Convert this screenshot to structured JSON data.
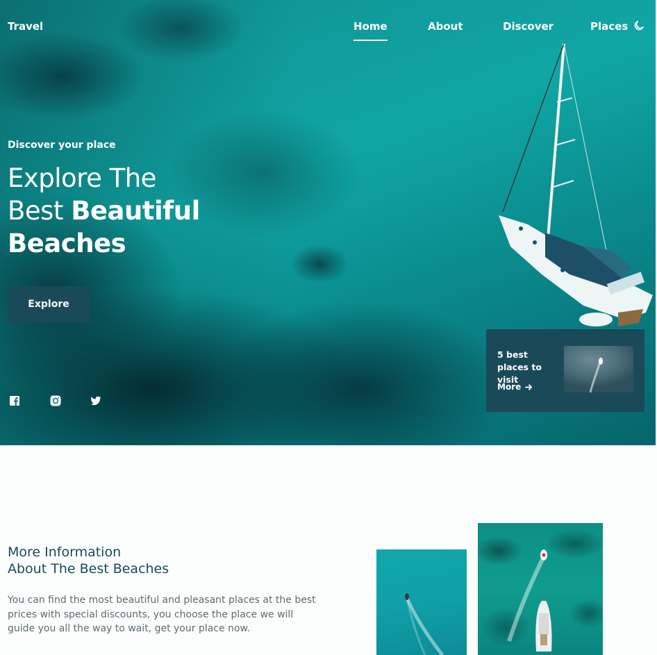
{
  "header": {
    "brand": "Travel",
    "nav": [
      {
        "label": "Home",
        "active": true
      },
      {
        "label": "About",
        "active": false
      },
      {
        "label": "Discover",
        "active": false
      },
      {
        "label": "Places",
        "active": false
      }
    ],
    "theme_toggle_icon": "moon-icon"
  },
  "hero": {
    "subtitle": "Discover your place",
    "headline_line1": "Explore The",
    "headline_line2_regular": "Best ",
    "headline_line2_bold": "Beautiful",
    "headline_line3_bold": "Beaches",
    "button_label": "Explore",
    "social_icons": [
      "facebook-icon",
      "instagram-icon",
      "twitter-icon"
    ]
  },
  "card": {
    "title": "5 best places to visit",
    "more_label": "More",
    "more_icon": "arrow-right-icon"
  },
  "info": {
    "title_line1": "More Information",
    "title_line2": "About The Best Beaches",
    "text": "You can find the most beautiful and pleasant places at the best prices with special discounts, you choose the place we will guide you all the way to wait, get your place now."
  },
  "colors": {
    "primary": "#1a4a57",
    "text_muted": "#5b6b70",
    "sea": "#10a6a5",
    "background": "#fbfefd"
  }
}
